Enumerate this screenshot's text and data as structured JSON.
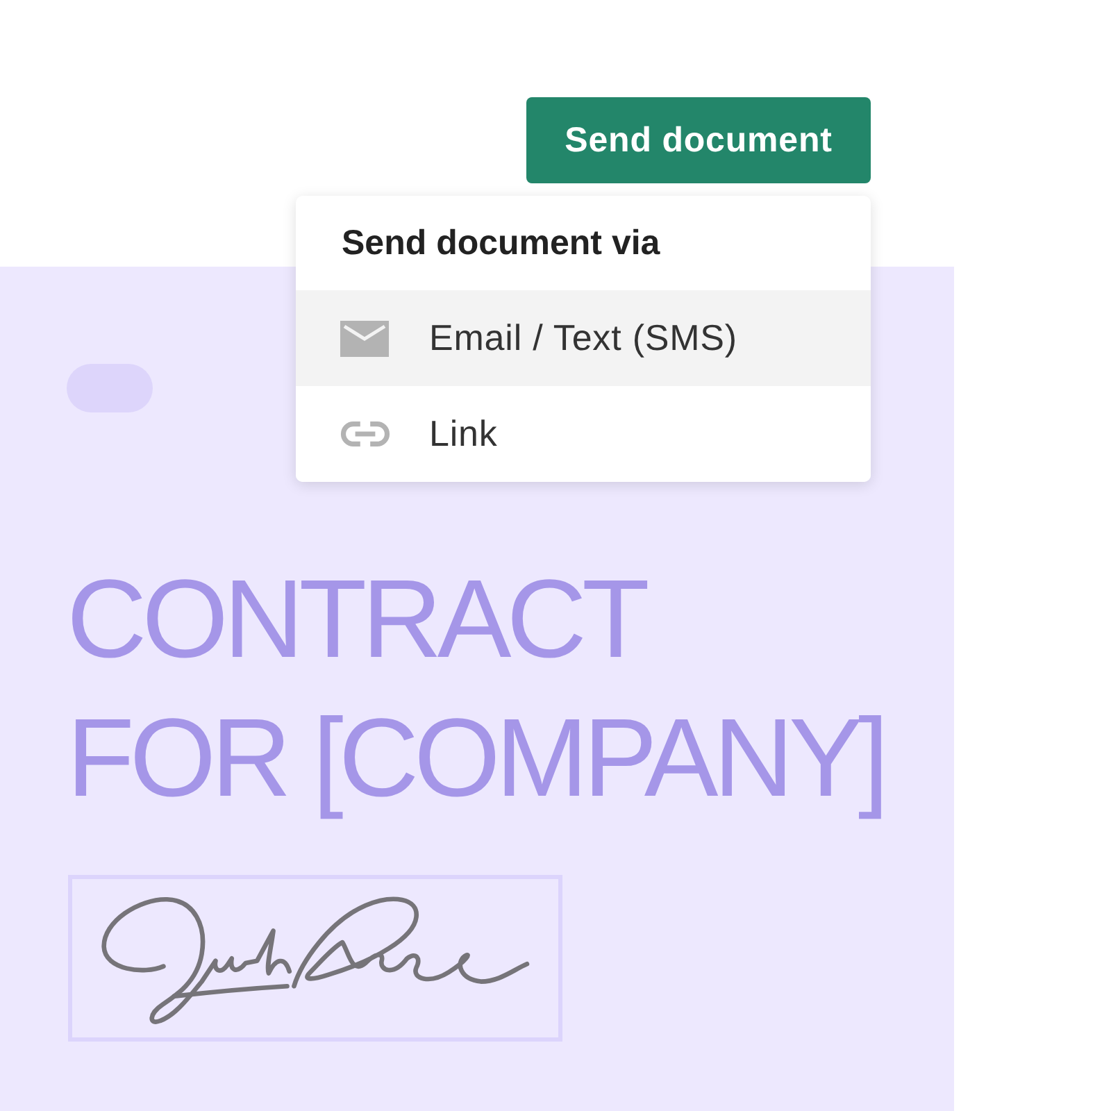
{
  "send_button": {
    "label": "Send document"
  },
  "send_menu": {
    "title": "Send document via",
    "items": [
      {
        "kind": "email",
        "label": "Email / Text (SMS)",
        "selected": true
      },
      {
        "kind": "link",
        "label": "Link",
        "selected": false
      }
    ]
  },
  "document": {
    "title_lines": [
      "CONTRACT",
      "FOR [COMPANY]"
    ]
  }
}
